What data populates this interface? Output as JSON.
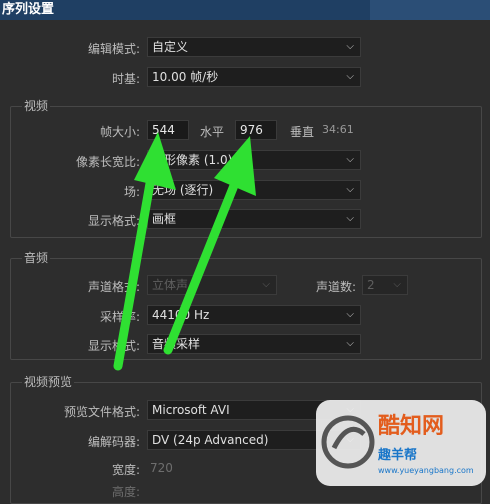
{
  "window": {
    "title": "序列设置"
  },
  "general": {
    "editing_mode": {
      "label": "编辑模式:",
      "value": "自定义"
    },
    "timebase": {
      "label": "时基:",
      "value": "10.00  帧/秒"
    }
  },
  "video": {
    "section_label": "视频",
    "frame_size": {
      "label": "帧大小:",
      "width": "544",
      "horizontal_label": "水平",
      "height": "976",
      "vertical_label": "垂直",
      "ratio": "34:61"
    },
    "pixel_aspect": {
      "label": "像素长宽比:",
      "value": "方形像素 (1.0)"
    },
    "fields": {
      "label": "场:",
      "value": "无场 (逐行)"
    },
    "display_format": {
      "label": "显示格式:",
      "value": "画框"
    }
  },
  "audio": {
    "section_label": "音频",
    "channel_format": {
      "label": "声道格式:",
      "value": "立体声"
    },
    "channels": {
      "label": "声道数:",
      "value": "2"
    },
    "sample_rate": {
      "label": "采样率:",
      "value": "44100 Hz"
    },
    "display_format": {
      "label": "显示格式:",
      "value": "音频采样"
    }
  },
  "preview": {
    "section_label": "视频预览",
    "file_format": {
      "label": "预览文件格式:",
      "value": "Microsoft AVI"
    },
    "codec": {
      "label": "编解码器:",
      "value": "DV (24p Advanced)"
    },
    "width": {
      "label": "宽度:",
      "value": "720"
    },
    "height": {
      "label": "高度:"
    }
  },
  "watermark": {
    "brand": "酷知网",
    "site": "趣羊帮",
    "url": "www.yueyangbang.com"
  },
  "colors": {
    "title_bar": "#1f3f63",
    "arrow": "#2fe032",
    "background": "#2d2d2d"
  }
}
